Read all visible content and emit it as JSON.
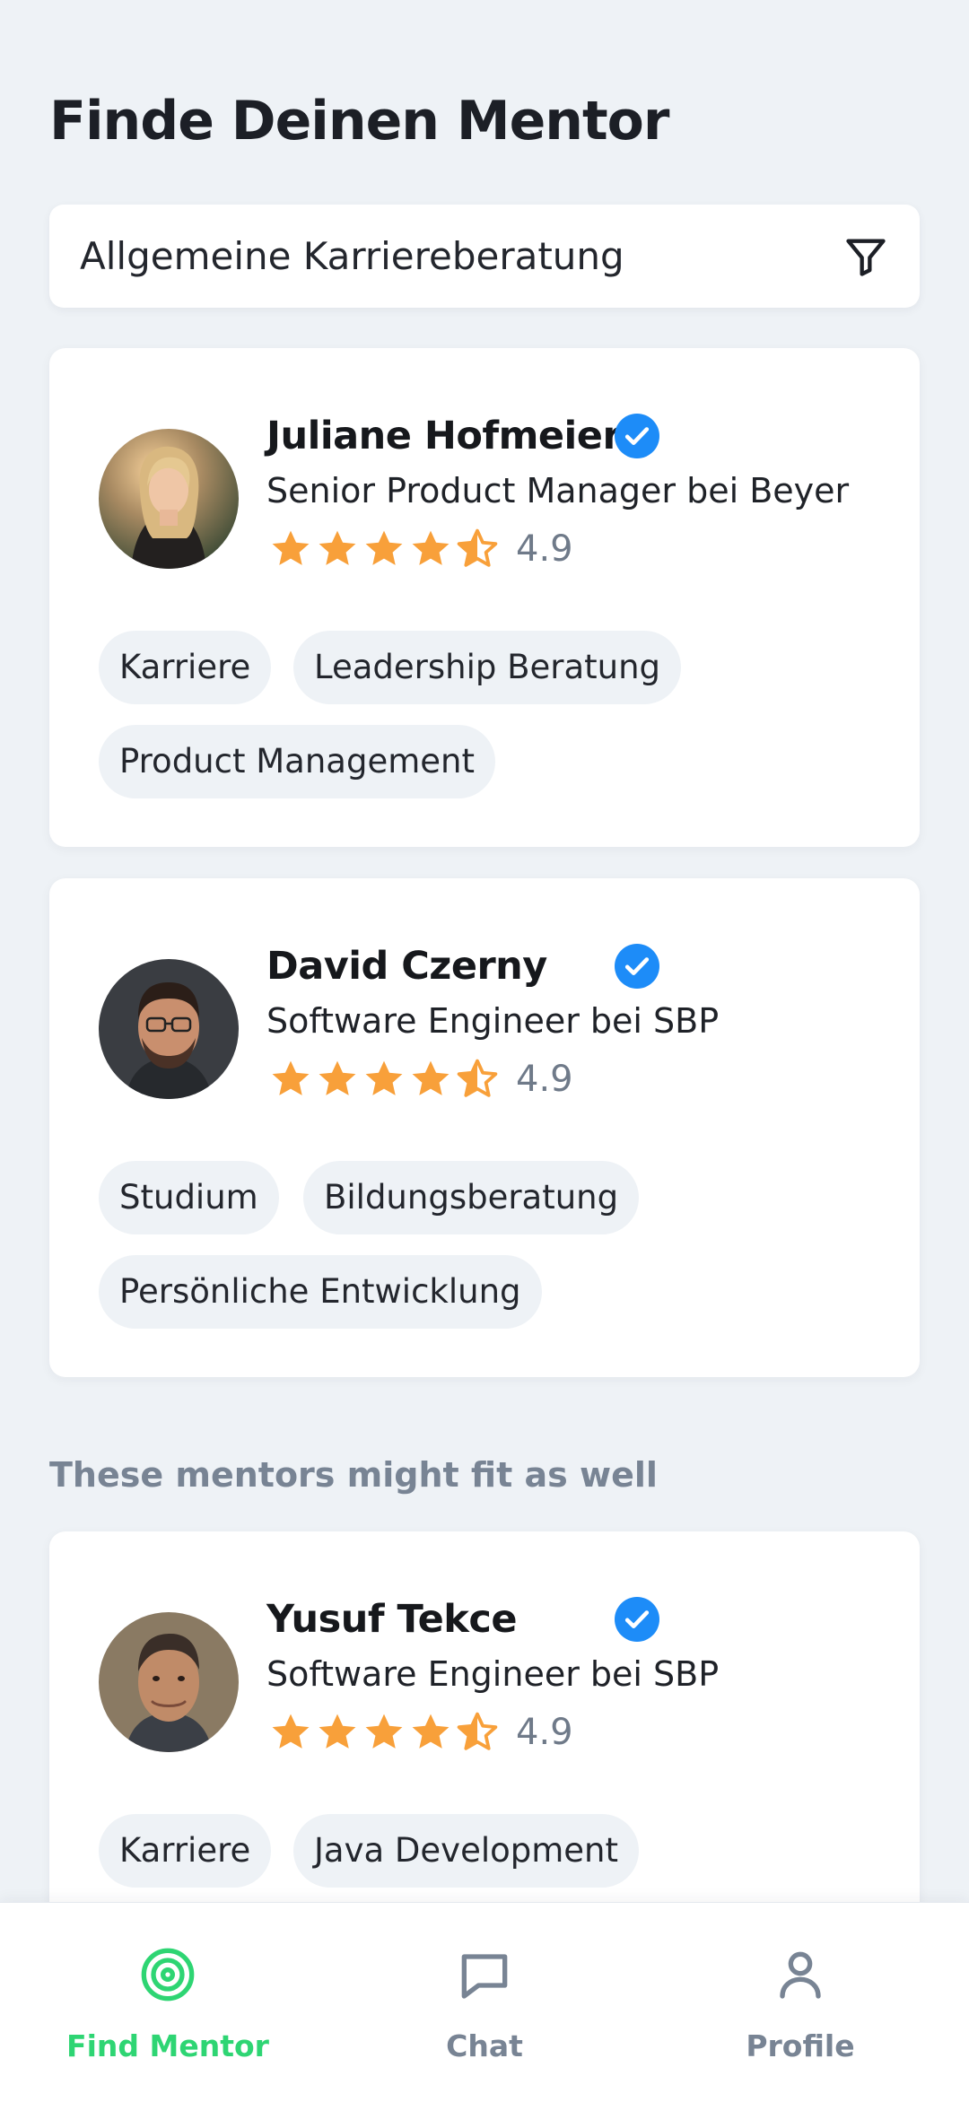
{
  "page": {
    "title": "Finde Deinen Mentor"
  },
  "search": {
    "value": "Allgemeine Karriereberatung",
    "filter_icon": "filter-icon"
  },
  "mentors": [
    {
      "name": "Juliane Hofmeier",
      "verified": true,
      "role": "Senior Product Manager bei Beyer",
      "rating": "4.9",
      "stars": 4.5,
      "tags": [
        "Karriere",
        "Leadership Beratung",
        "Product Management"
      ]
    },
    {
      "name": "David Czerny",
      "verified": true,
      "role": "Software Engineer bei SBP",
      "rating": "4.9",
      "stars": 4.5,
      "tags": [
        "Studium",
        "Bildungsberatung",
        "Persönliche Entwicklung"
      ]
    }
  ],
  "suggestions": {
    "heading": "These mentors might fit as well",
    "mentors": [
      {
        "name": "Yusuf Tekce",
        "verified": true,
        "role": "Software Engineer bei SBP",
        "rating": "4.9",
        "stars": 4.5,
        "tags": [
          "Karriere",
          "Java Development"
        ]
      }
    ]
  },
  "bottom_nav": {
    "items": [
      {
        "label": "Find Mentor",
        "icon": "target-icon",
        "active": true
      },
      {
        "label": "Chat",
        "icon": "chat-bubble-icon",
        "active": false
      },
      {
        "label": "Profile",
        "icon": "user-icon",
        "active": false
      }
    ]
  },
  "colors": {
    "background": "#eef2f6",
    "card": "#ffffff",
    "accent_green": "#2ed573",
    "verified_blue": "#1d8cf8",
    "star_orange": "#f8a03a",
    "muted_text": "#788494"
  }
}
